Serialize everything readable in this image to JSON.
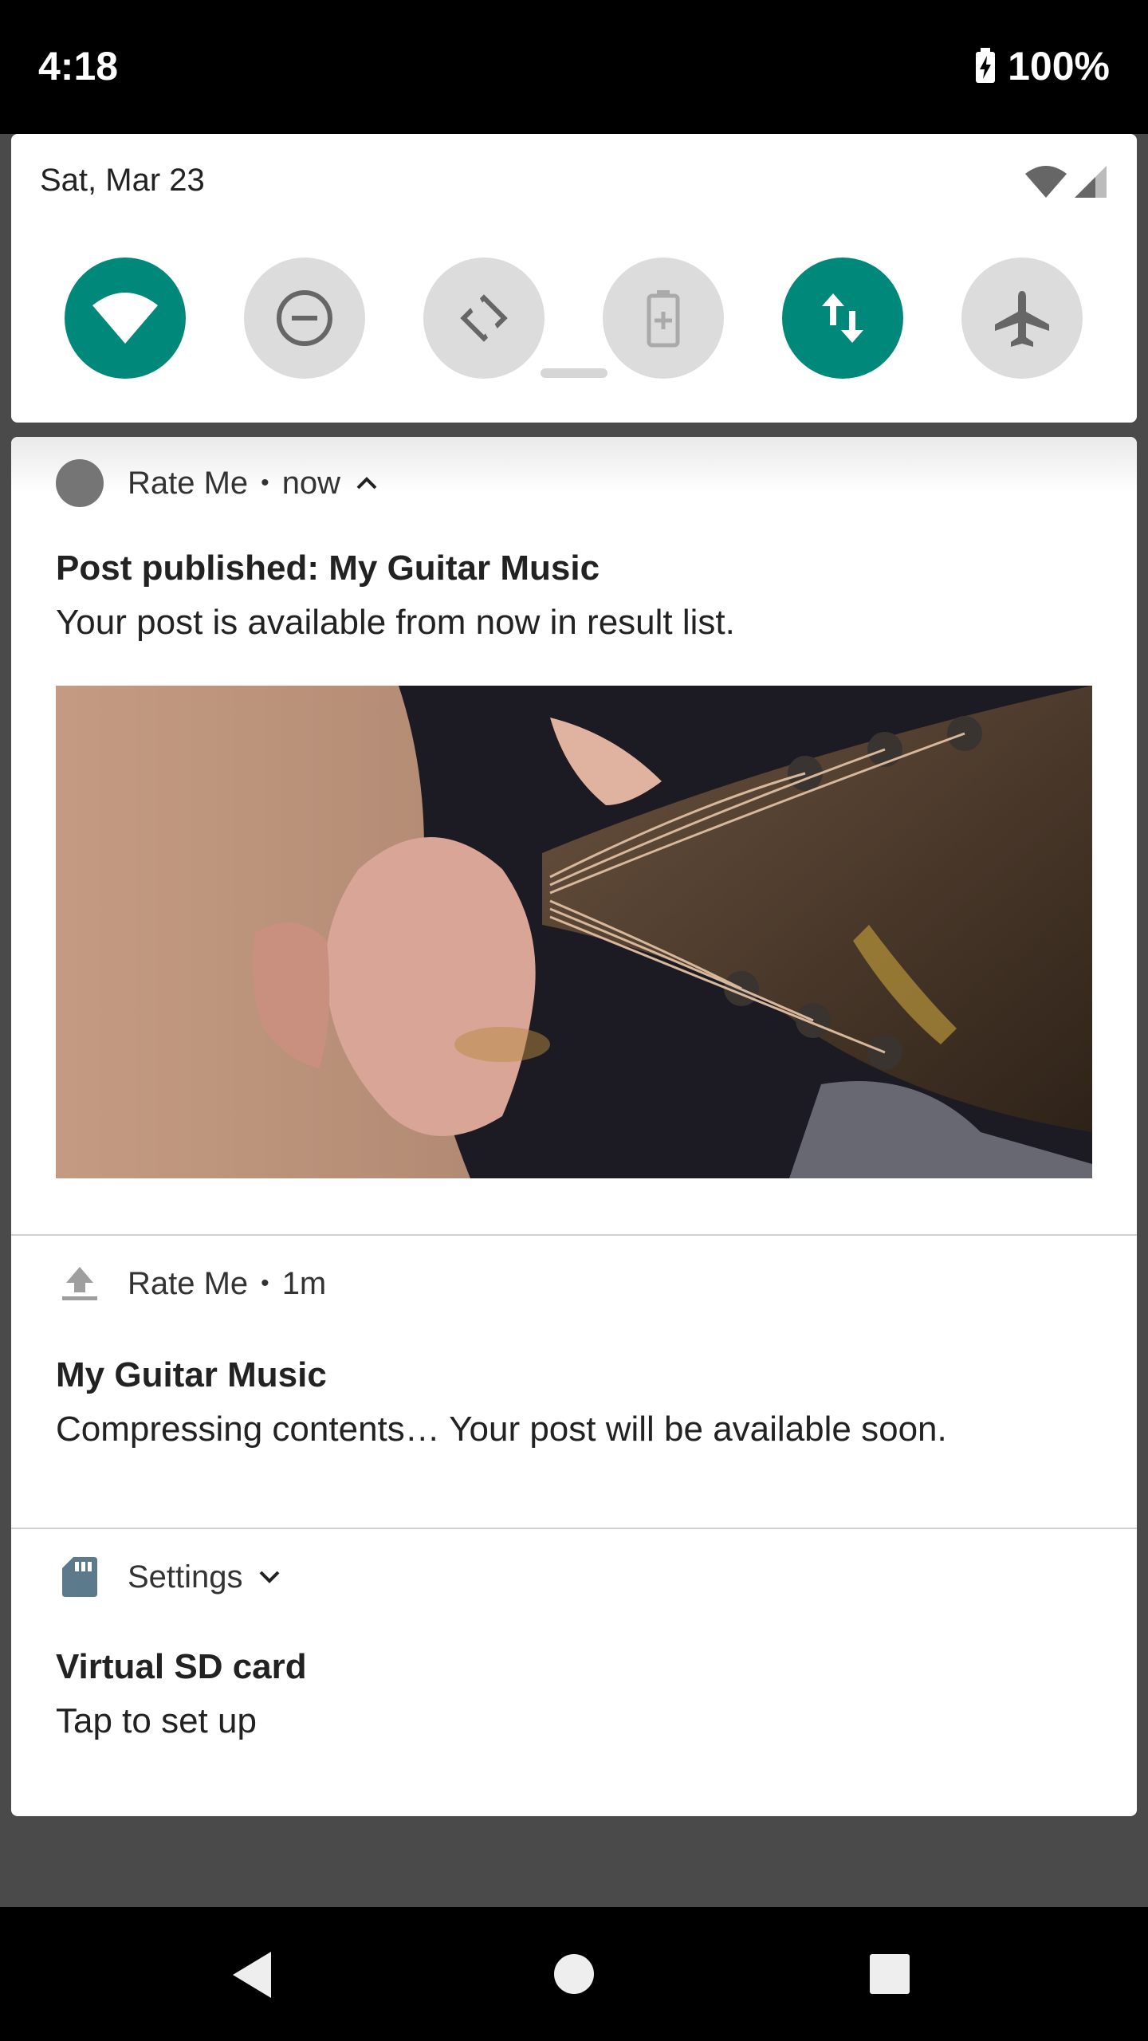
{
  "status_bar": {
    "time": "4:18",
    "battery_percent": "100%"
  },
  "quick_settings": {
    "date": "Sat, Mar 23",
    "accent_color": "#00897b",
    "tiles": [
      {
        "icon": "wifi-icon",
        "state": "on"
      },
      {
        "icon": "do-not-disturb-icon",
        "state": "off"
      },
      {
        "icon": "auto-rotate-icon",
        "state": "off"
      },
      {
        "icon": "battery-saver-icon",
        "state": "off"
      },
      {
        "icon": "mobile-data-icon",
        "state": "on"
      },
      {
        "icon": "airplane-mode-icon",
        "state": "off"
      }
    ]
  },
  "notifications": [
    {
      "app": "Rate Me",
      "time": "now",
      "icon": "app-circle-icon",
      "expanded": true,
      "title": "Post published: My Guitar Music",
      "text": "Your post is available from now in result list.",
      "image": "guitar-photo"
    },
    {
      "app": "Rate Me",
      "time": "1m",
      "icon": "upload-icon",
      "title": "My Guitar Music",
      "text": "Compressing contents… Your post will be available soon."
    },
    {
      "app": "Settings",
      "icon": "sd-card-icon",
      "title": "Virtual SD card",
      "text": "Tap to set up"
    }
  ],
  "nav_bar": {
    "buttons": [
      "back-icon",
      "home-icon",
      "recents-icon"
    ]
  }
}
